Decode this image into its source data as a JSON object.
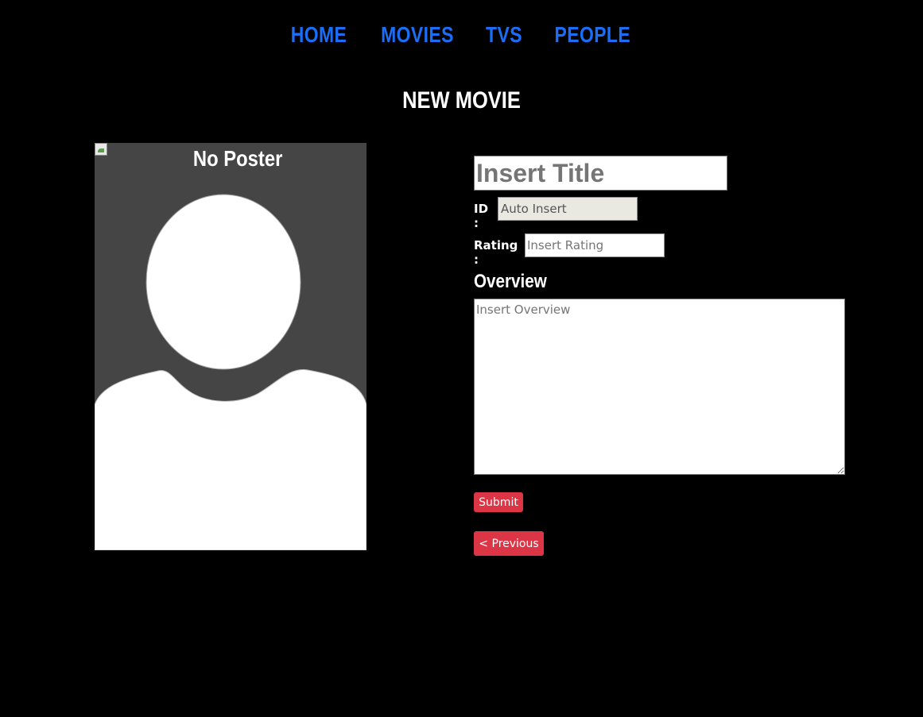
{
  "nav": {
    "items": [
      {
        "label": "HOME"
      },
      {
        "label": "MOVIES"
      },
      {
        "label": "TVS"
      },
      {
        "label": "PEOPLE"
      }
    ]
  },
  "page": {
    "title": "NEW MOVIE"
  },
  "poster": {
    "alt_text": "No Poster",
    "icon": "broken-image-icon"
  },
  "form": {
    "title_placeholder": "Insert Title",
    "title_value": "",
    "id_label": "ID :",
    "id_placeholder": "Auto Insert",
    "rating_label": "Rating :",
    "rating_placeholder": "Insert Rating",
    "overview_label": "Overview",
    "overview_placeholder": "Insert Overview",
    "submit_label": "Submit",
    "previous_label": "< Previous"
  },
  "colors": {
    "background": "#000000",
    "nav_link": "#1b6ef5",
    "button": "#dc3545",
    "poster_bg": "#454545"
  }
}
